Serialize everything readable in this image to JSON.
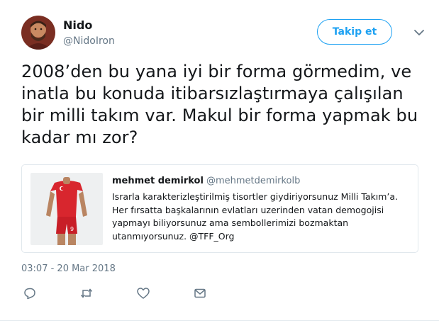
{
  "user": {
    "display_name": "Nido",
    "handle": "@NidoIron",
    "follow_label": "Takip et"
  },
  "tweet": {
    "text": "2008’den bu yana iyi bir forma görmedim, ve inatla bu konuda itibarsızlaştırmaya çalışılan bir milli takım var. Makul bir forma yapmak bu kadar mı zor?",
    "timestamp": "03:07 - 20 Mar 2018"
  },
  "quoted_tweet": {
    "author_name": "mehmet demirkol",
    "author_handle": "@mehmetdemirkolb",
    "text": "Israrla karakterizleştirilmiş tisortler giydiriyorsunuz Milli Takım’a. Her fırsatta başkalarının evlatları uzerinden vatan demogojisi yapmayı biliyorsunuz ama sembollerimizi bozmaktan utanmıyorsunuz. @TFF_Org",
    "jersey_number": "9"
  },
  "actions": {
    "icons": [
      "reply-icon",
      "retweet-icon",
      "like-icon",
      "direct-message-icon"
    ]
  },
  "colors": {
    "accent": "#1da1f2",
    "secondary_text": "#657786",
    "border": "#e1e8ed",
    "jersey_red": "#d8262e"
  }
}
